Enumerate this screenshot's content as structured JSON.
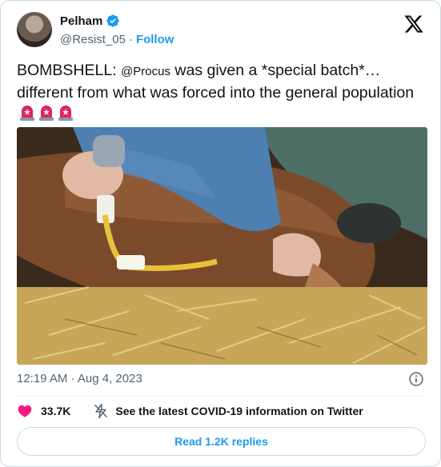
{
  "author": {
    "name": "Pelham",
    "handle": "@Resist_05",
    "separator": "·",
    "follow_label": "Follow"
  },
  "tweet": {
    "text_before": "BOMBSHELL: ",
    "mention": "@Procus",
    "text_after": " was given a *special batch*… different from what was forced into the general population "
  },
  "meta": {
    "timestamp": "12:19 AM · Aug 4, 2023"
  },
  "actions": {
    "likes": "33.7K",
    "covid_info": "See the latest COVID-19 information on Twitter"
  },
  "replies_button": "Read 1.2K replies",
  "icons": [
    "verified-badge-icon",
    "x-logo-icon",
    "siren-icon",
    "info-icon",
    "heart-icon",
    "lightning-icon"
  ],
  "colors": {
    "accent": "#1d9bf0",
    "heart": "#f91880",
    "text": "#0f1419",
    "secondary": "#536471",
    "siren": "#e0245e"
  }
}
